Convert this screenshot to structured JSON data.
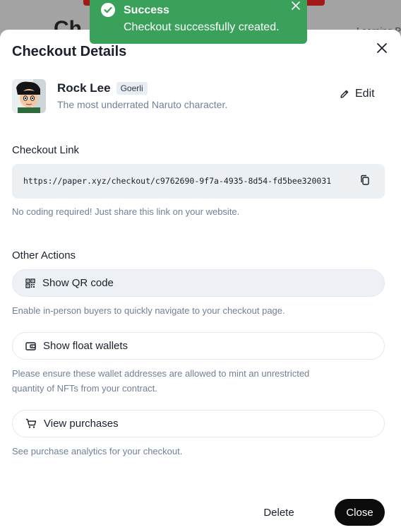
{
  "background": {
    "heading": "Ch",
    "right_text": "Learning P"
  },
  "toast": {
    "title": "Success",
    "message": "Checkout successfully created."
  },
  "modal": {
    "title": "Checkout Details",
    "profile": {
      "name": "Rock Lee",
      "network": "Goerli",
      "description": "The most underrated Naruto character."
    },
    "edit_label": "Edit",
    "checkout_link": {
      "label": "Checkout Link",
      "url": "https://paper.xyz/checkout/c9762690-9f7a-4935-8d54-fd5bee320031",
      "help": "No coding required! Just share this link on your website."
    },
    "other_actions": {
      "label": "Other Actions",
      "qr": {
        "label": "Show QR code",
        "help": "Enable in-person buyers to quickly navigate to your checkout page."
      },
      "float_wallets": {
        "label": "Show float wallets",
        "help_line1": "Please ensure these wallet addresses are allowed to mint an unrestricted",
        "help_line2": "quantity of NFTs from your contract."
      },
      "purchases": {
        "label": "View purchases",
        "help": "See purchase analytics for your checkout."
      }
    },
    "delete_label": "Delete",
    "close_label": "Close"
  },
  "colors": {
    "toast_bg": "#3aa15b",
    "primary_button": "#0c0c0c",
    "link_box_bg": "#edf0f3",
    "muted_text": "#718096"
  }
}
